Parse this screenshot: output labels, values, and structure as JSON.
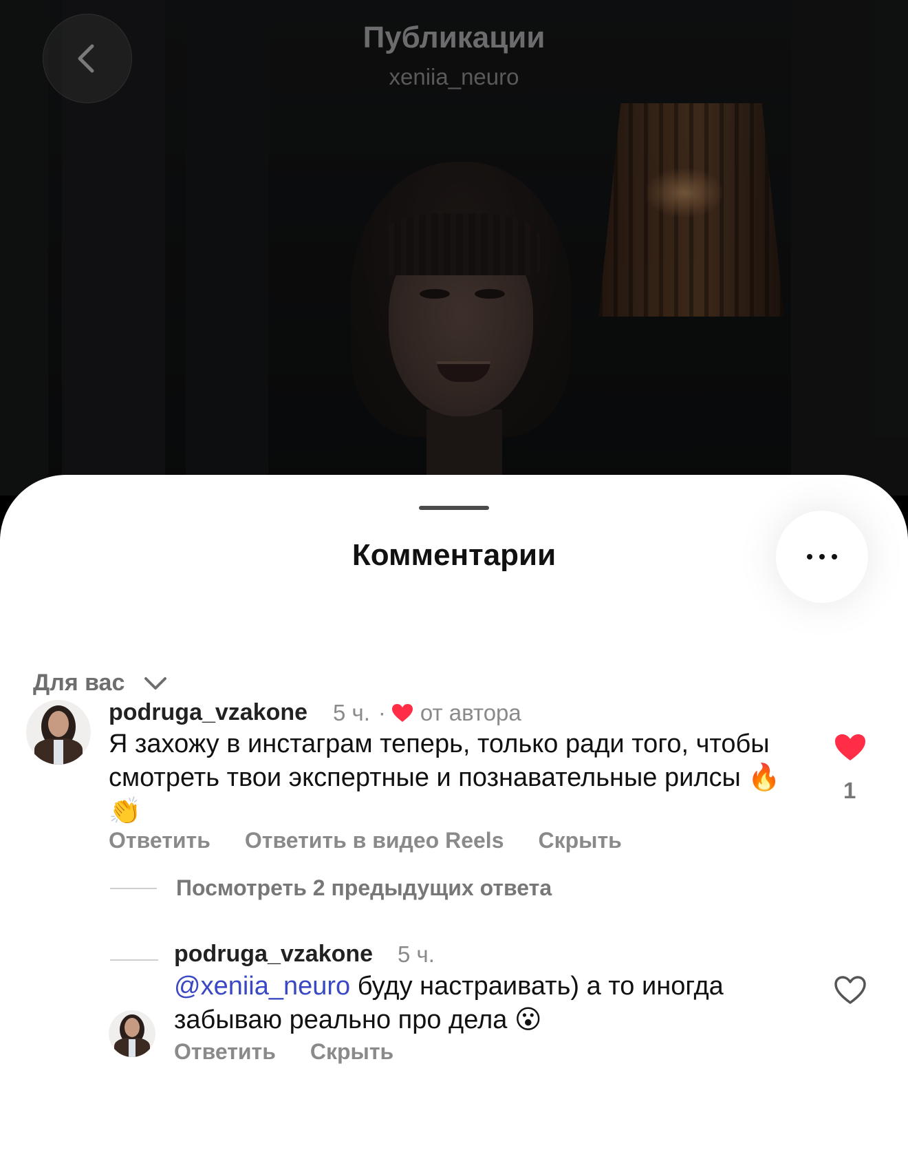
{
  "header": {
    "title": "Публикации",
    "subtitle": "xeniia_neuro",
    "back_icon": "chevron-left-icon"
  },
  "sheet": {
    "title": "Комментарии",
    "more_icon": "more-horizontal-icon",
    "filter_label": "Для вас",
    "filter_icon": "chevron-down-icon"
  },
  "comments": [
    {
      "username": "podruga_vzakone",
      "time": "5 ч.",
      "separator": "·",
      "liked_by_author_label": "от автора",
      "text": "Я захожу в инстаграм теперь, только ради того, чтобы смотреть твои экспертные и познавательные рилсы",
      "emojis": "🔥👏",
      "liked": true,
      "like_count": "1",
      "actions": [
        "Ответить",
        "Ответить в видео Reels",
        "Скрыть"
      ]
    }
  ],
  "view_replies_label": "Посмотреть 2 предыдущих ответа",
  "reply": {
    "username": "podruga_vzakone",
    "time": "5 ч.",
    "mention": "@xeniia_neuro",
    "text": " буду настраивать) а то иногда забываю реально про дела",
    "emoji": "😮",
    "liked": false,
    "actions": [
      "Ответить",
      "Скрыть"
    ]
  },
  "colors": {
    "like_red": "#ff2d45",
    "mention_blue": "#3a48c4",
    "muted_text": "#8a8a8a"
  }
}
